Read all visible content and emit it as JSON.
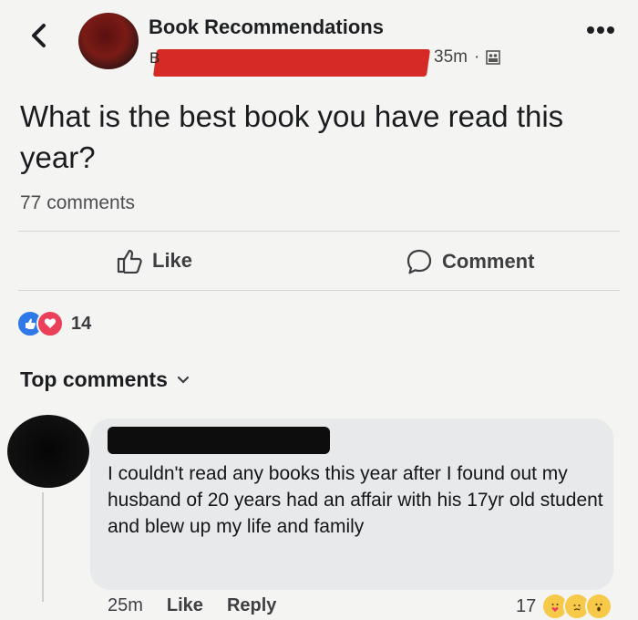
{
  "header": {
    "group_name": "Book Recommendations",
    "author_initial": "B",
    "time": "35m",
    "separator": "·",
    "more_label": "•••",
    "back_icon": "chevron-left-icon"
  },
  "post": {
    "text": "What is the best book you have read this year?",
    "comment_count": "77 comments",
    "like_label": "Like",
    "comment_label": "Comment",
    "reaction_count": "14"
  },
  "top_comments": {
    "label": "Top comments"
  },
  "comment": {
    "text": "I couldn't read any books this year after I found out my husband of 20 years had an affair with his 17yr old student and blew up my life and family",
    "time": "25m",
    "like_label": "Like",
    "reply_label": "Reply",
    "reaction_count": "17"
  },
  "colors": {
    "like_blue": "#2f78e8",
    "love_red": "#ec3f5a",
    "redact_red": "#d52a25",
    "bubble": "#e7e9ea"
  }
}
